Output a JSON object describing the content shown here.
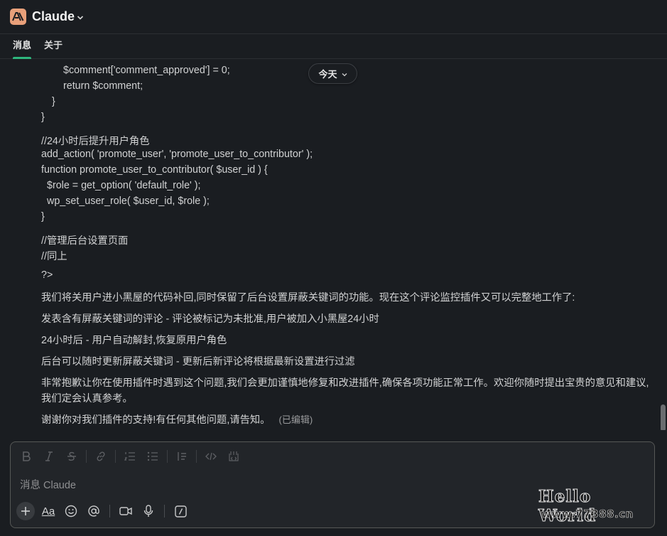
{
  "app": {
    "title": "Claude"
  },
  "tabs": [
    {
      "label": "消息",
      "active": true
    },
    {
      "label": "关于",
      "active": false
    }
  ],
  "date_divider": {
    "label": "今天"
  },
  "message": {
    "code_lines": [
      "$comment['comment_approved'] = 0;",
      "return $comment;",
      "}",
      "}",
      "//24小时后提升用户角色",
      "add_action( 'promote_user', 'promote_user_to_contributor' );",
      "function promote_user_to_contributor( $user_id ) {",
      "$role = get_option( 'default_role' );",
      "wp_set_user_role( $user_id, $role );",
      "}",
      "//管理后台设置页面",
      "//同上",
      "?>"
    ],
    "paragraphs": [
      "我们将关用户进小黑屋的代码补回,同时保留了后台设置屏蔽关键词的功能。现在这个评论监控插件又可以完整地工作了:",
      "发表含有屏蔽关键词的评论 - 评论被标记为未批准,用户被加入小黑屋24小时",
      "24小时后 - 用户自动解封,恢复原用户角色",
      "后台可以随时更新屏蔽关键词 - 更新后新评论将根据最新设置进行过滤",
      "非常抱歉让你在使用插件时遇到这个问题,我们会更加谨慎地修复和改进插件,确保各项功能正常工作。欢迎你随时提出宝贵的意见和建议,我们定会认真参考。",
      "谢谢你对我们插件的支持!有任何其他问题,请告知。"
    ],
    "edited_label": "(已编辑)"
  },
  "composer": {
    "placeholder": "消息 Claude",
    "format_icons": [
      "bold-icon",
      "italic-icon",
      "strikethrough-icon",
      "link-icon",
      "ordered-list-icon",
      "bulleted-list-icon",
      "block-quote-icon",
      "code-icon",
      "code-block-icon"
    ],
    "action_icons": [
      "plus-icon",
      "text-format-icon",
      "emoji-icon",
      "mention-icon",
      "video-icon",
      "microphone-icon",
      "slash-command-icon"
    ],
    "aa_label": "Aa"
  },
  "watermark": {
    "title": "Hello World",
    "url": "www.77388.cn"
  },
  "colors": {
    "accent_tab": "#2eb67d",
    "logo_bg": "#e8a07a",
    "background": "#1a1d21"
  }
}
